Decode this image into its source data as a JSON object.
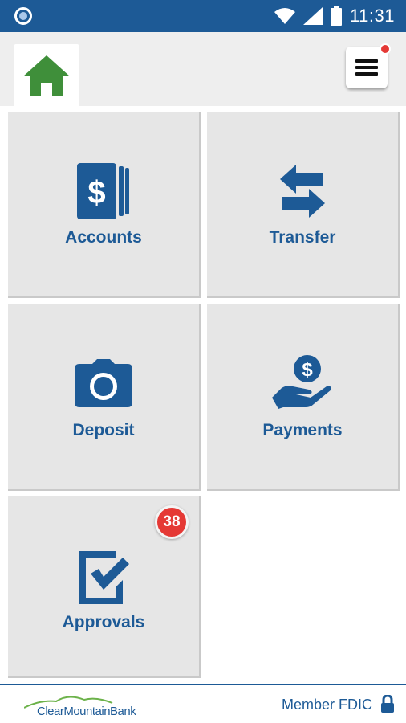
{
  "status_bar": {
    "time": "11:31"
  },
  "header": {
    "home_icon": "home-icon",
    "menu_icon": "hamburger-menu-icon"
  },
  "tiles": [
    {
      "label": "Accounts",
      "icon": "accounts-dollar-cards-icon"
    },
    {
      "label": "Transfer",
      "icon": "transfer-arrows-icon"
    },
    {
      "label": "Deposit",
      "icon": "camera-icon"
    },
    {
      "label": "Payments",
      "icon": "hand-coin-icon"
    },
    {
      "label": "Approvals",
      "icon": "checkbox-approval-icon",
      "badge": "38"
    }
  ],
  "footer": {
    "brand": "ClearMountainBank",
    "fdic_label": "Member FDIC"
  },
  "colors": {
    "brand_blue": "#1d5a96",
    "home_green": "#3f8f3a",
    "badge_red": "#e53935",
    "tile_bg": "#e6e6e6"
  }
}
